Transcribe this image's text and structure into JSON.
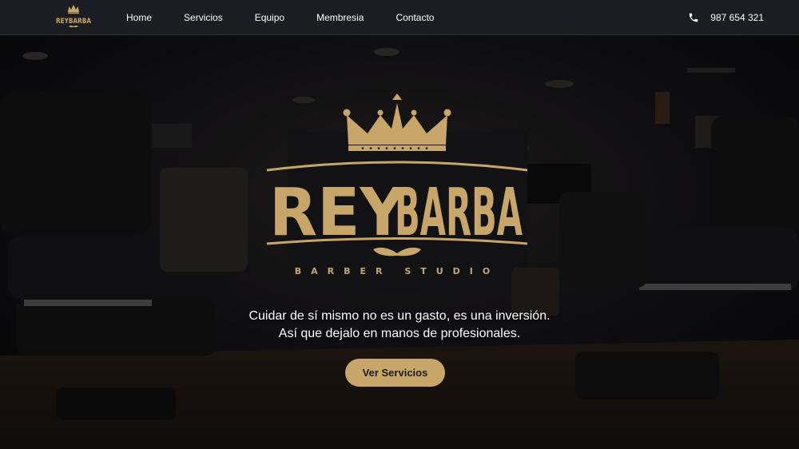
{
  "nav": {
    "logo_text": "REYBARBA",
    "links": [
      "Home",
      "Servicios",
      "Equipo",
      "Membresia",
      "Contacto"
    ],
    "phone": "987 654 321",
    "phone_icon": "phone-icon"
  },
  "hero": {
    "brand_name": "REYBARBA",
    "brand_word_1": "REY",
    "brand_word_2": "BARBA",
    "brand_subtitle": "BARBER STUDIO",
    "tagline_line_1": "Cuidar de sí mismo no es un gasto, es una inversión.",
    "tagline_line_2": "Así que dejalo en manos de profesionales.",
    "cta_label": "Ver Servicios"
  },
  "colors": {
    "nav_background": "#1b1d22",
    "gold": "#c8a568",
    "text": "#ffffff"
  }
}
